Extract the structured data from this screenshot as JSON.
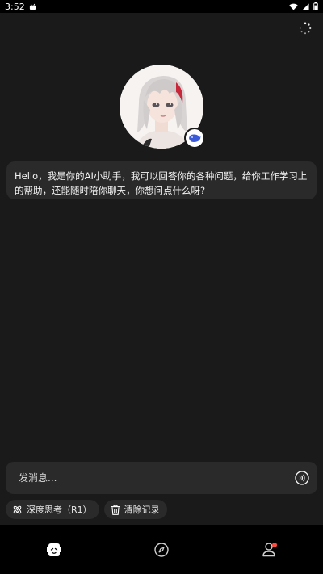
{
  "status_bar": {
    "time": "3:52"
  },
  "greeting": "Hello，我是你的AI小助手，我可以回答你的各种问题，给你工作学习上的帮助，还能随时陪你聊天，你想问点什么呀?",
  "input": {
    "placeholder": "发消息..."
  },
  "chips": {
    "deep_think_label": "深度思考（R1）",
    "clear_label": "清除记录"
  },
  "colors": {
    "background": "#1a1a1a",
    "bubble": "#2a2a2a",
    "nav_background": "#000000",
    "notification_dot": "#ff4b3e",
    "badge_whale": "#3b5bdb"
  },
  "icons": {
    "loading": "loading-icon",
    "whale_badge": "whale-badge-icon",
    "voice": "voice-icon",
    "deep_think": "atom-icon",
    "clear": "trash-icon",
    "nav_chat": "bot-face-icon",
    "nav_discover": "compass-icon",
    "nav_profile": "profile-icon"
  }
}
